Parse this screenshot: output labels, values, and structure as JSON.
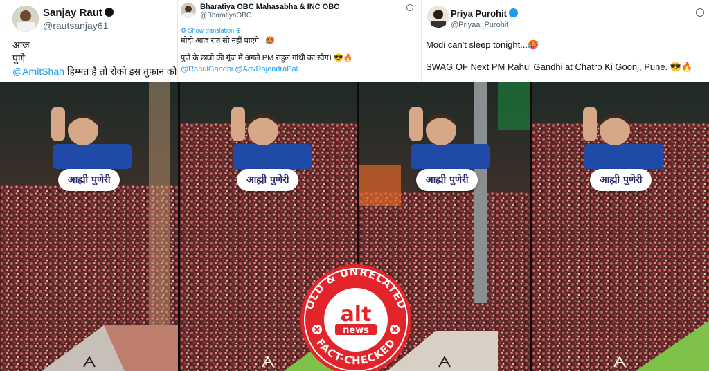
{
  "tweets": [
    {
      "name": "Sanjay Raut",
      "handle": "@rautsanjay61",
      "lines": [
        "आज",
        "पुणे"
      ],
      "mention": "@AmitShah",
      "last_line": "हिम्मत है तो रोको इस तुफान को.."
    },
    {
      "name": "Bharatiya OBC Mahasabha & INC OBC",
      "handle": "@BharatiyaOBC",
      "show_translation": "Show translation",
      "line1": "मोदी आज रात सो नहीं पाएंगे...🥵",
      "line2": "पुणे के छात्रो की गूंज में अगले PM राहुल गांधी का स्वैग। 😎🔥",
      "mentions": "@RahulGandhi @AdvRajendraPal"
    },
    {
      "name": "Priya Purohit",
      "handle": "@Priyaa_Purohit",
      "line1": "Modi can't sleep tonight...🥵",
      "line2": "SWAG OF Next PM Rahul Gandhi at Chatro Ki Goonj, Pune. 😎🔥"
    }
  ],
  "panel_caption": "आह्मी पुणेरी",
  "badge": {
    "top_text": "OLD & UNRELATED",
    "bottom_text": "FACT-CHECKED",
    "logo_alt": "alt",
    "logo_news": "news"
  },
  "colors": {
    "verified_blue": "#1d9bf0",
    "badge_red": "#e3242b",
    "jersey_blue": "#1f4aa8"
  }
}
